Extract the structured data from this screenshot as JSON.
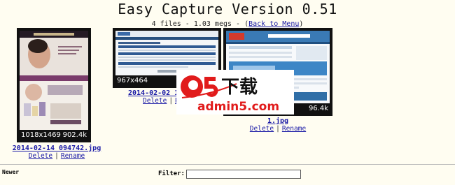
{
  "header": {
    "title": "Easy Capture Version 0.51",
    "subtitle_files": "4 files",
    "subtitle_size": "1.03 megs",
    "back_link": "Back to Menu"
  },
  "images": [
    {
      "filename": "2014-02-14 094742.jpg",
      "dimensions": "1018x1469",
      "size": "902.4k",
      "delete_label": "Delete",
      "rename_label": "Rename"
    },
    {
      "filename": "2014-02-02 15",
      "dimensions": "967x464",
      "size": "9",
      "delete_label": "Delete",
      "rename_label": "Re"
    },
    {
      "filename": "1.jpg",
      "dimensions": "9",
      "size": "96.4k",
      "delete_label": "Delete",
      "rename_label": "Rename"
    }
  ],
  "watermark": {
    "brand": "a5",
    "cn_text": "下载",
    "domain": "admin5.com"
  },
  "footer": {
    "sort_label": "Newer",
    "filter_label": "Filter:",
    "filter_value": ""
  },
  "colors": {
    "background": "#fffdf1",
    "link": "#1a1aa6",
    "watermark_red": "#e11b1b"
  }
}
